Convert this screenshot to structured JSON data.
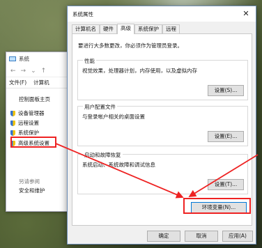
{
  "explorer": {
    "title": "系统",
    "menu_file": "文件(F)",
    "menu_computer": "计算机",
    "home_link": "控制面板主页",
    "items": [
      "设备管理器",
      "远程设置",
      "系统保护",
      "高级系统设置"
    ],
    "see_also": "另请参阅",
    "security": "安全和维护"
  },
  "dialog": {
    "title": "系统属性",
    "close": "✕",
    "tabs": [
      "计算机名",
      "硬件",
      "高级",
      "系统保护",
      "远程"
    ],
    "note": "要进行大多数更改，你必须作为管理员登录。",
    "performance": {
      "title": "性能",
      "desc": "视觉效果，处理器计划，内存使用，以及虚拟内存",
      "button": "设置(S)..."
    },
    "profile": {
      "title": "用户配置文件",
      "desc": "与登录帐户相关的桌面设置",
      "button": "设置(E)..."
    },
    "startup": {
      "title": "启动和故障恢复",
      "desc": "系统启动、系统故障和调试信息",
      "button": "设置(T)..."
    },
    "env_button": "环境变量(N)...",
    "ok": "确定",
    "cancel": "取消",
    "apply": "应用(A)"
  },
  "colors": {
    "accent": "#0078d7",
    "annotation": "#e22222"
  }
}
